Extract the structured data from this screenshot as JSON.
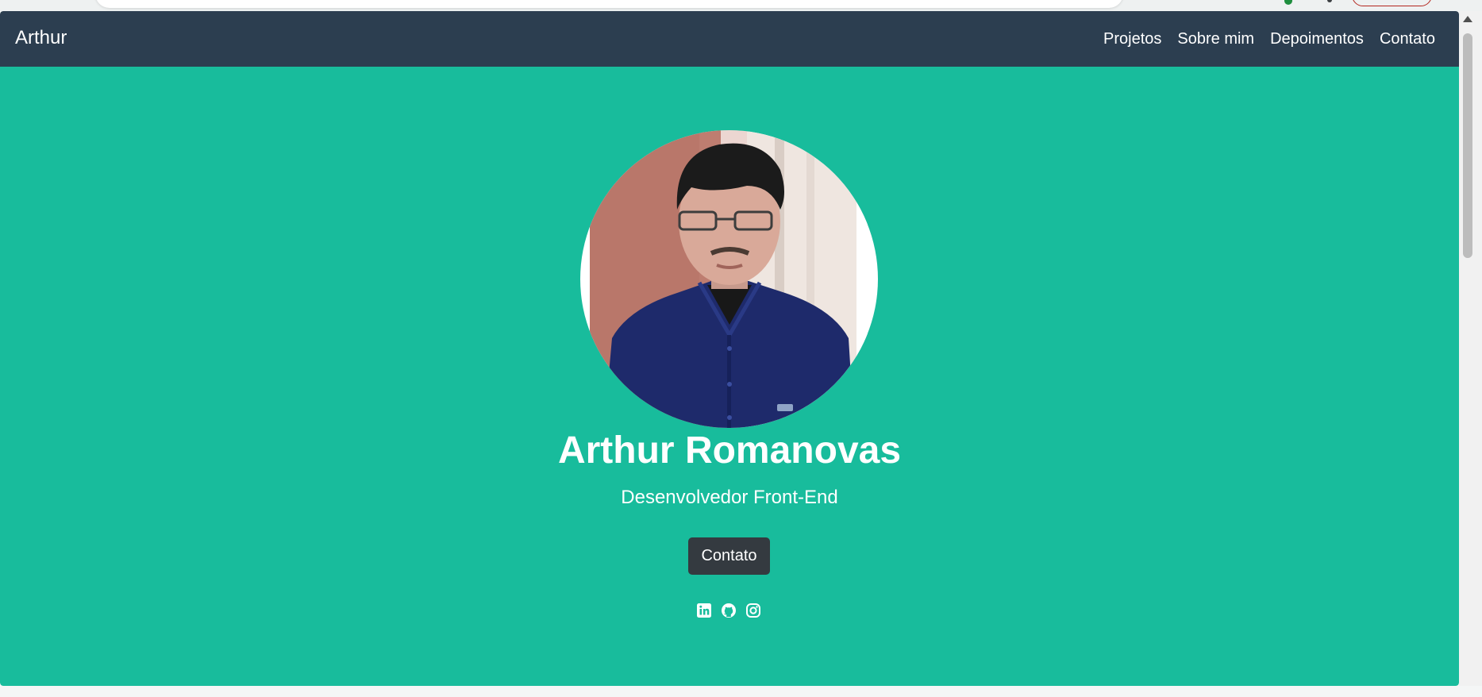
{
  "navbar": {
    "brand": "Arthur",
    "links": [
      "Projetos",
      "Sobre mim",
      "Depoimentos",
      "Contato"
    ]
  },
  "hero": {
    "name": "Arthur Romanovas",
    "subtitle": "Desenvolvedor Front-End",
    "button_label": "Contato",
    "avatar_icon": "profile-photo",
    "socials": [
      "linkedin-icon",
      "github-icon",
      "instagram-icon"
    ]
  },
  "colors": {
    "navbar": "#2c3e50",
    "hero": "#18bc9c",
    "button": "#343a40"
  }
}
